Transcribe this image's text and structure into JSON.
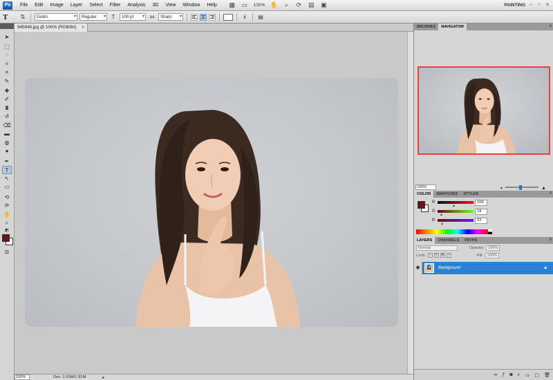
{
  "app": {
    "logo_text": "Ps"
  },
  "menu": [
    "File",
    "Edit",
    "Image",
    "Layer",
    "Select",
    "Filter",
    "Analysis",
    "3D",
    "View",
    "Window",
    "Help"
  ],
  "menubar_tools": {
    "zoom": "100%",
    "workspace": "PAINTING"
  },
  "options_bar": {
    "font_family": "Gulim",
    "font_style": "Regular",
    "font_size": "100 pt",
    "antialias_icon_text": "aa",
    "antialias": "Sharp"
  },
  "document": {
    "tab_title": "945948.jpg @ 100% (RGB/8#)",
    "tab_close": "×",
    "status_zoom": "100%",
    "status_doc": "Doc: 1.91M/1.91M"
  },
  "panels": {
    "top_tabs": [
      "BRUSHES",
      "NAVIGATOR"
    ],
    "navigator_zoom": "100%",
    "color_tabs": [
      "COLOR",
      "SWATCHES",
      "STYLES"
    ],
    "color": {
      "r_label": "R",
      "r": "109",
      "g_label": "G",
      "g": "18",
      "b_label": "B",
      "b": "23",
      "foreground_hex": "#6d1219",
      "background_hex": "#ffffff"
    },
    "layers_tabs": [
      "LAYERS",
      "CHANNELS",
      "PATHS"
    ],
    "layers": {
      "blend_mode": "Normal",
      "opacity_label": "Opacity:",
      "opacity": "100%",
      "lock_label": "Lock:",
      "fill_label": "Fill:",
      "fill": "100%",
      "items": [
        {
          "name": "Background"
        }
      ]
    }
  }
}
